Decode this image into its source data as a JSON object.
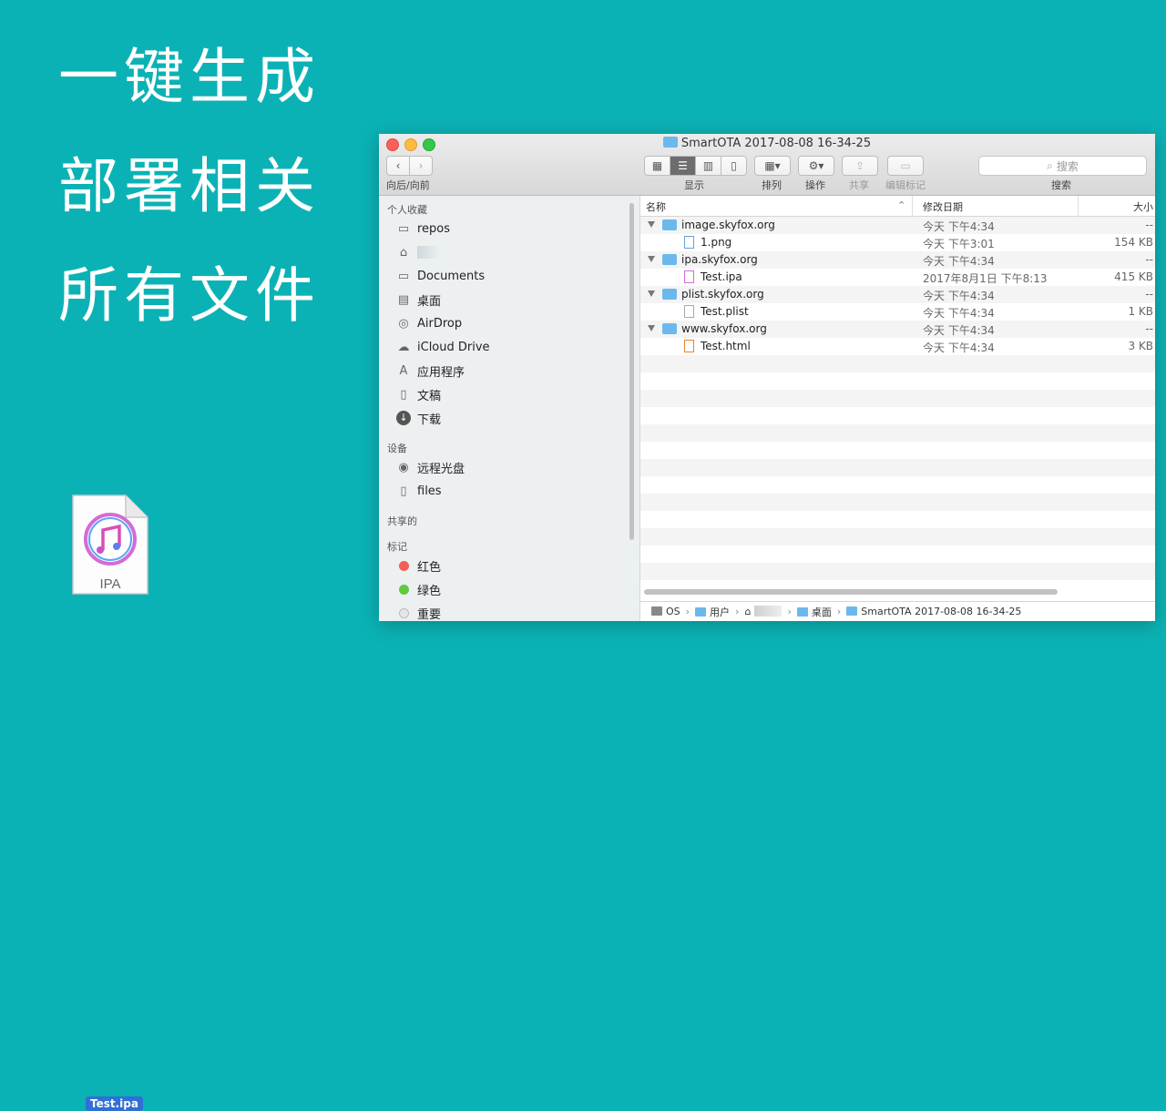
{
  "promo": {
    "line1": "一键生成",
    "line2": "部署相关",
    "line3": "所有文件"
  },
  "desktop": {
    "doc_text": "IPA",
    "file_label": "Test.ipa"
  },
  "window": {
    "title": "SmartOTA 2017-08-08 16-34-25",
    "toolbar": {
      "nav_label": "向后/向前",
      "view_label": "显示",
      "arrange_label": "排列",
      "action_label": "操作",
      "share_label": "共享",
      "tags_label": "编辑标记",
      "search_label": "搜索",
      "search_placeholder": "搜索"
    },
    "sidebar": {
      "favorites_header": "个人收藏",
      "favorites": [
        {
          "label": "repos",
          "icon": "folder-icon"
        },
        {
          "label": "",
          "icon": "home-icon"
        },
        {
          "label": "Documents",
          "icon": "folder-icon"
        },
        {
          "label": "桌面",
          "icon": "desktop-icon"
        },
        {
          "label": "AirDrop",
          "icon": "airdrop-icon"
        },
        {
          "label": "iCloud Drive",
          "icon": "cloud-icon"
        },
        {
          "label": "应用程序",
          "icon": "applications-icon"
        },
        {
          "label": "文稿",
          "icon": "documents-icon"
        },
        {
          "label": "下载",
          "icon": "download-icon"
        }
      ],
      "devices_header": "设备",
      "devices": [
        {
          "label": "远程光盘",
          "icon": "disc-icon"
        },
        {
          "label": "files",
          "icon": "drive-icon"
        }
      ],
      "shared_header": "共享的",
      "tags_header": "标记",
      "tags": [
        {
          "label": "红色",
          "color": "#f25e58"
        },
        {
          "label": "绿色",
          "color": "#5fc93f"
        },
        {
          "label": "重要",
          "color": "#e6e6e6"
        }
      ]
    },
    "columns": {
      "name": "名称",
      "date": "修改日期",
      "size": "大小"
    },
    "rows": [
      {
        "name": "image.skyfox.org",
        "date": "今天 下午4:34",
        "size": "--",
        "type": "folder"
      },
      {
        "name": "1.png",
        "date": "今天 下午3:01",
        "size": "154 KB",
        "type": "file"
      },
      {
        "name": "ipa.skyfox.org",
        "date": "今天 下午4:34",
        "size": "--",
        "type": "folder"
      },
      {
        "name": "Test.ipa",
        "date": "2017年8月1日 下午8:13",
        "size": "415 KB",
        "type": "file"
      },
      {
        "name": "plist.skyfox.org",
        "date": "今天 下午4:34",
        "size": "--",
        "type": "folder"
      },
      {
        "name": "Test.plist",
        "date": "今天 下午4:34",
        "size": "1 KB",
        "type": "file"
      },
      {
        "name": "www.skyfox.org",
        "date": "今天 下午4:34",
        "size": "--",
        "type": "folder"
      },
      {
        "name": "Test.html",
        "date": "今天 下午4:34",
        "size": "3 KB",
        "type": "file"
      }
    ],
    "path": [
      "OS",
      "用户",
      "",
      "桌面",
      "SmartOTA 2017-08-08 16-34-25"
    ]
  }
}
